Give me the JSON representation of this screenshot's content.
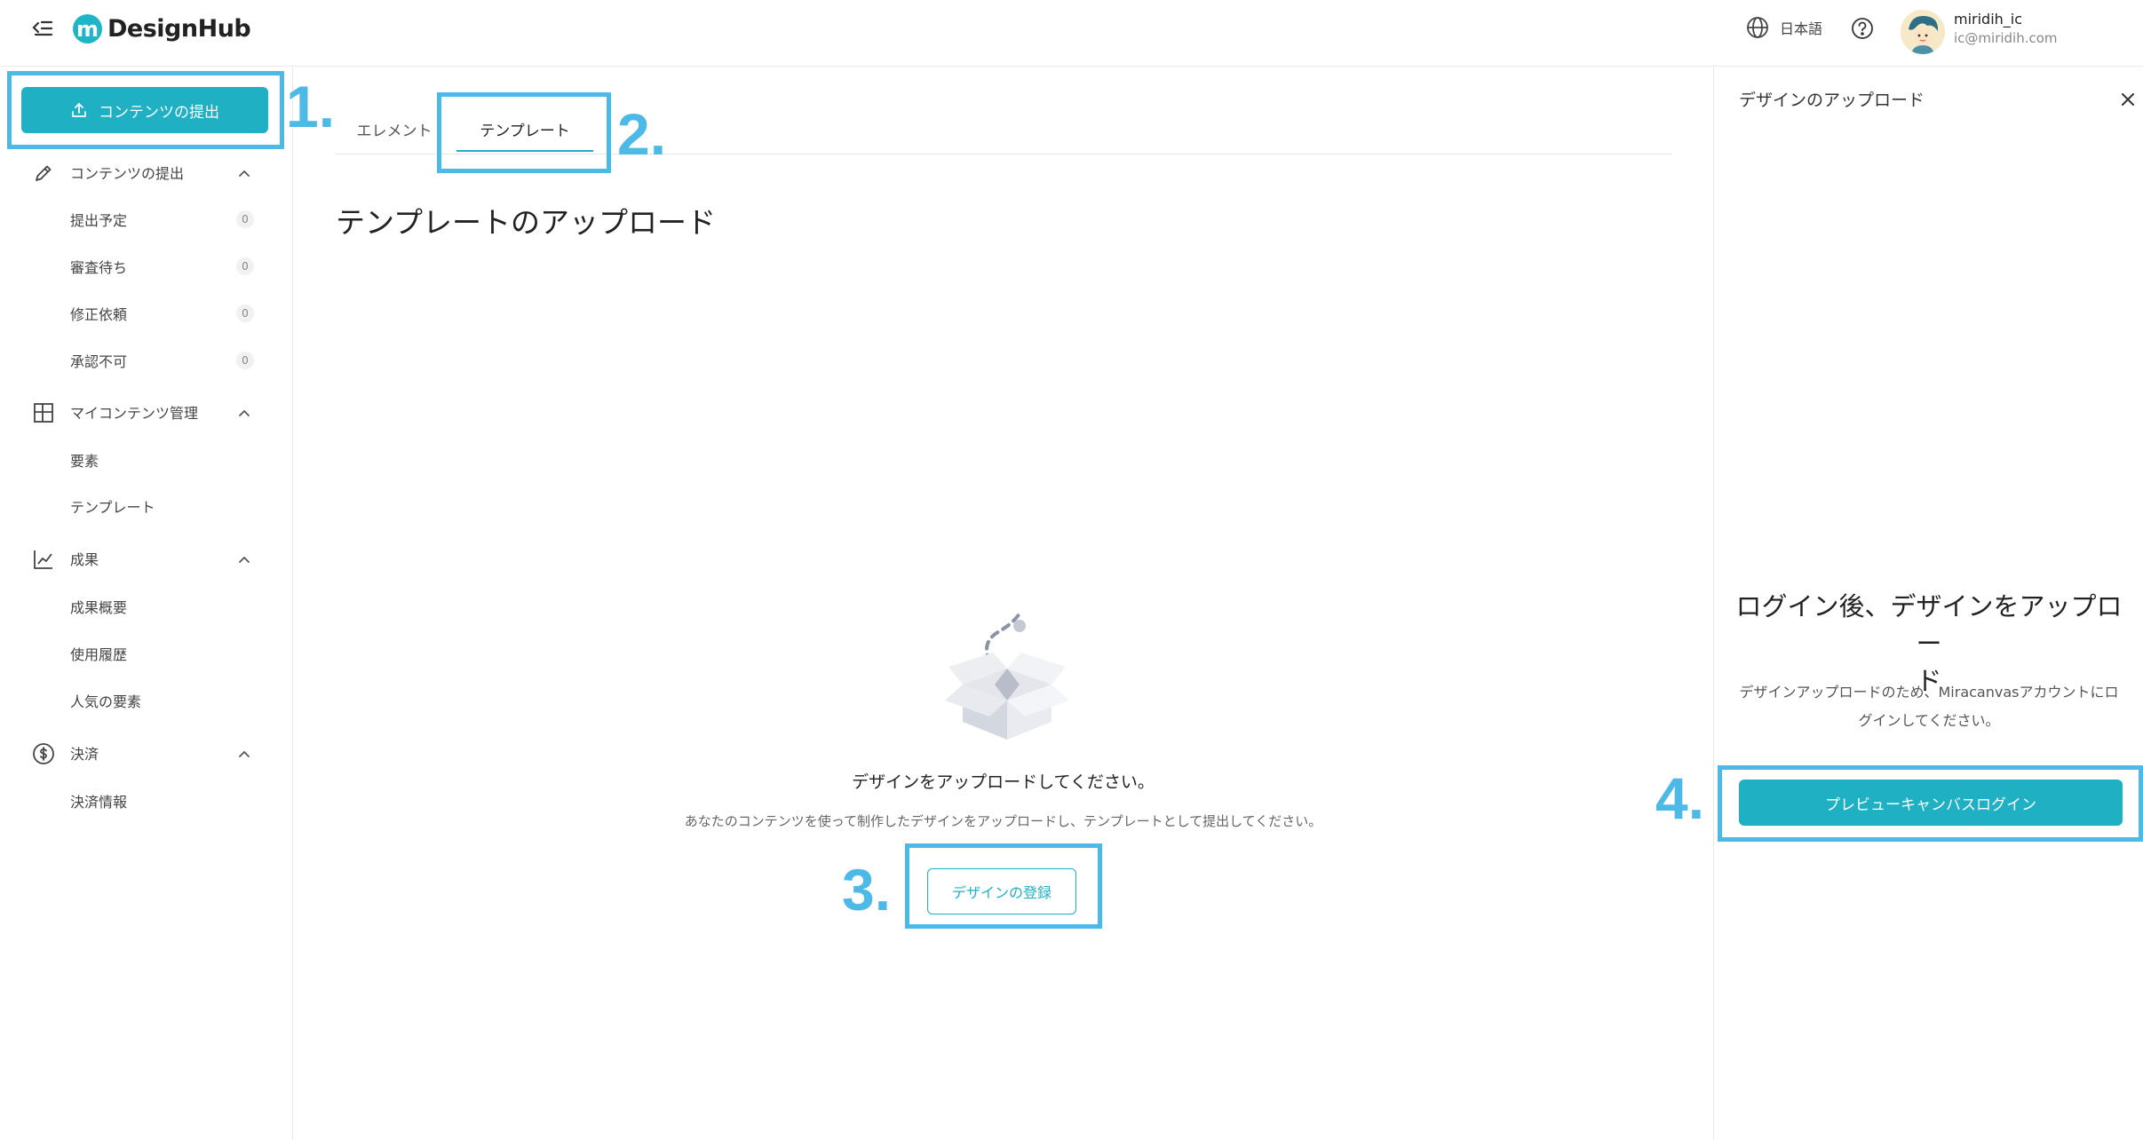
{
  "app": {
    "logo_letter": "m",
    "name": "DesignHub"
  },
  "header": {
    "language_label": "日本語",
    "user_name": "miridih_ic",
    "user_email": "ic@miridih.com"
  },
  "sidebar": {
    "primary_button": "コンテンツの提出",
    "sections": [
      {
        "label": "コンテンツの提出",
        "icon": "pencil-icon",
        "items": [
          {
            "label": "提出予定",
            "count": "0"
          },
          {
            "label": "審査待ち",
            "count": "0"
          },
          {
            "label": "修正依頼",
            "count": "0"
          },
          {
            "label": "承認不可",
            "count": "0"
          }
        ]
      },
      {
        "label": "マイコンテンツ管理",
        "icon": "layout-grid-icon",
        "items": [
          {
            "label": "要素"
          },
          {
            "label": "テンプレート"
          }
        ]
      },
      {
        "label": "成果",
        "icon": "line-chart-icon",
        "items": [
          {
            "label": "成果概要"
          },
          {
            "label": "使用履歴"
          },
          {
            "label": "人気の要素"
          }
        ]
      },
      {
        "label": "決済",
        "icon": "dollar-circle-icon",
        "items": [
          {
            "label": "決済情報"
          }
        ]
      }
    ]
  },
  "main": {
    "tabs": [
      {
        "label": "エレメント"
      },
      {
        "label": "テンプレート"
      }
    ],
    "active_tab": "テンプレート",
    "page_title": "テンプレートのアップロード",
    "empty_title": "デザインをアップロードしてください。",
    "empty_description": "あなたのコンテンツを使って制作したデザインをアップロードし、テンプレートとして提出してください。",
    "register_button": "デザインの登録"
  },
  "right_panel": {
    "title": "デザインのアップロード",
    "heading_line1": "ログイン後、デザインをアップロー",
    "heading_line2": "ド",
    "description_line1": "デザインアップロードのため、Miracanvasアカウントにロ",
    "description_line2": "グインしてください。",
    "login_button": "プレビューキャンバスログイン"
  },
  "annotations": {
    "colors": {
      "highlight": "#4db9e6",
      "accent": "#1fb0c3"
    },
    "labels": [
      "1.",
      "2.",
      "3.",
      "4."
    ]
  }
}
